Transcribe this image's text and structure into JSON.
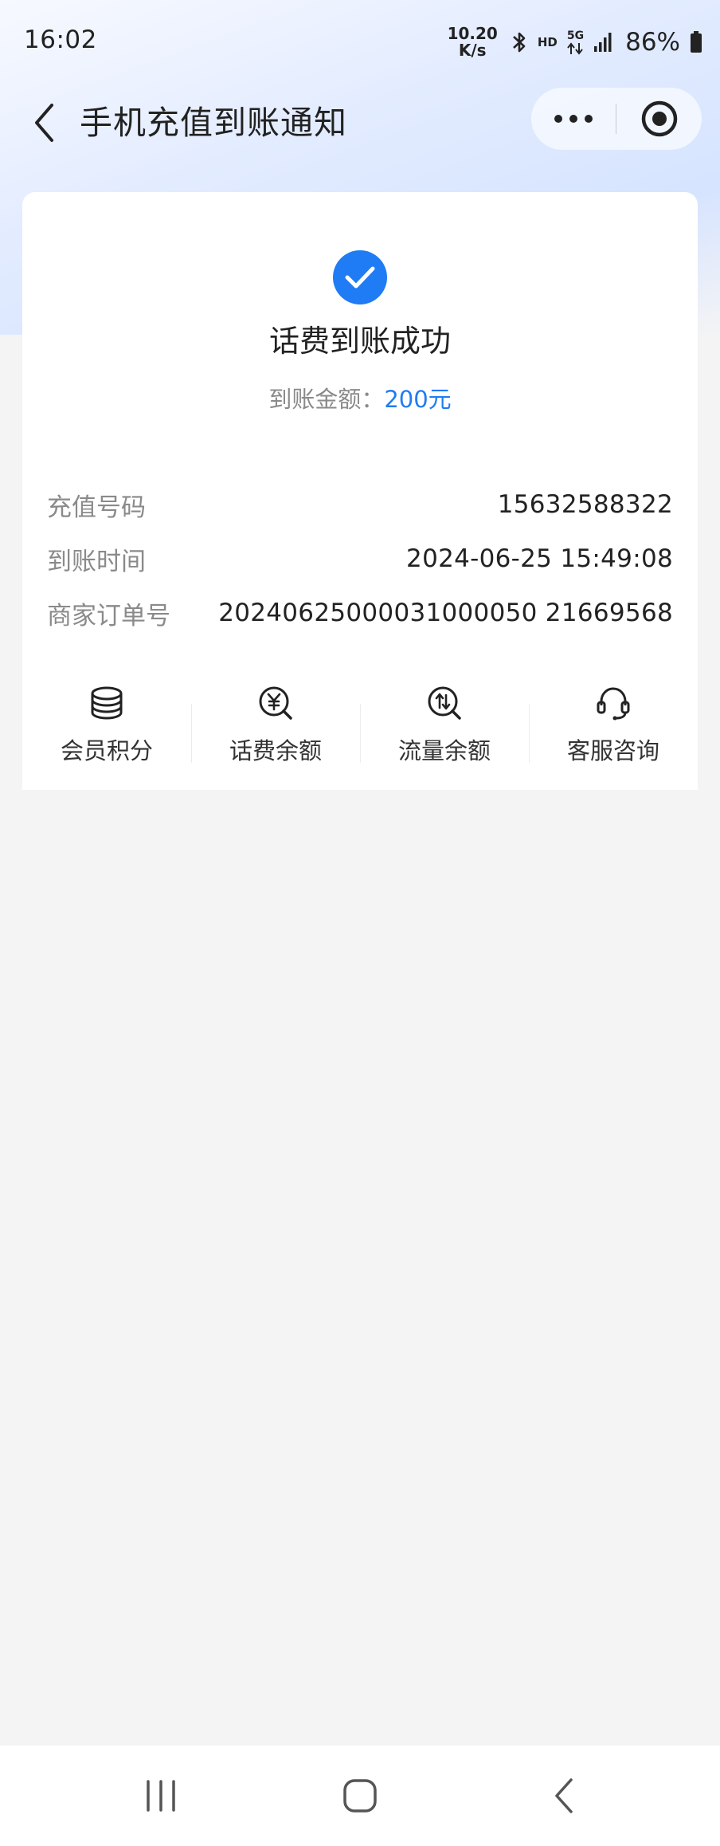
{
  "status_bar": {
    "time": "16:02",
    "net_speed_value": "10.20",
    "net_speed_unit": "K/s",
    "hd_label": "HD",
    "network_label": "5G",
    "battery_percent": "86%",
    "icons": [
      "bluetooth-icon",
      "signal-icon",
      "battery-icon",
      "data-arrows-icon"
    ]
  },
  "header": {
    "title": "手机充值到账通知",
    "icons": [
      "back-arrow-icon",
      "more-dots-icon",
      "close-target-icon"
    ]
  },
  "result": {
    "icon": "check-circle-icon",
    "accent_color": "#1f7cf4",
    "title": "话费到账成功",
    "amount_label": "到账金额：",
    "amount_value": "200元"
  },
  "details": [
    {
      "label": "充值号码",
      "value": "15632588322"
    },
    {
      "label": "到账时间",
      "value": "2024-06-25 15:49:08"
    },
    {
      "label": "商家订单号",
      "value": "20240625000031000050 21669568"
    }
  ],
  "actions": [
    {
      "label": "会员积分",
      "icon": "coins-stack-icon"
    },
    {
      "label": "话费余额",
      "icon": "yuan-search-icon"
    },
    {
      "label": "流量余额",
      "icon": "data-search-icon"
    },
    {
      "label": "客服咨询",
      "icon": "headset-icon"
    }
  ],
  "system_nav": {
    "icons": [
      "recent-apps-icon",
      "home-icon",
      "back-icon"
    ]
  }
}
